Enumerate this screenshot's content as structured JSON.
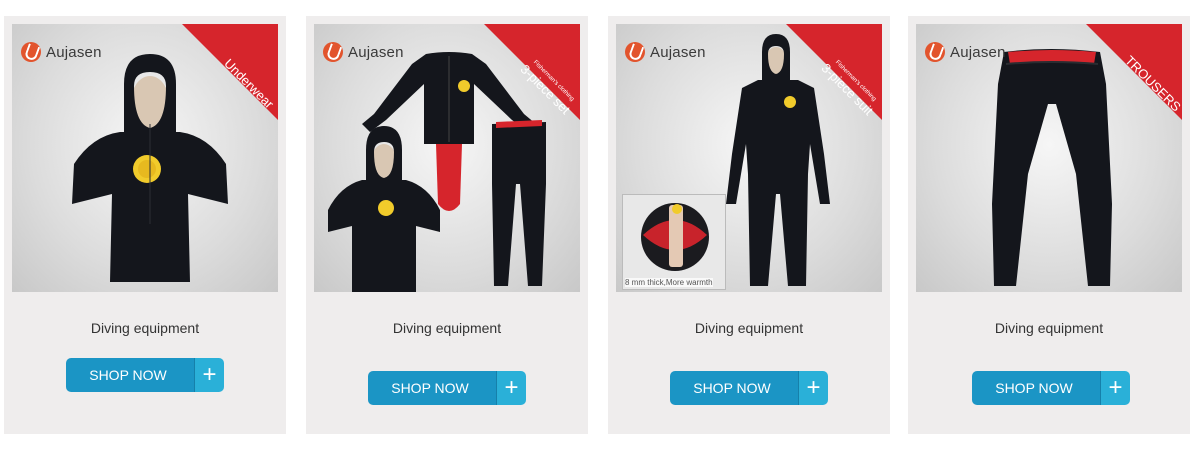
{
  "brand": "Aujasen",
  "products": [
    {
      "ribbon_small": "",
      "ribbon_big": "Underwear",
      "title": "Diving equipment",
      "button_label": "SHOP NOW",
      "plus_icon": "+"
    },
    {
      "ribbon_small": "Fisherman's clothing",
      "ribbon_big": "3-piece set",
      "title": "Diving equipment",
      "button_label": "SHOP NOW",
      "plus_icon": "+"
    },
    {
      "ribbon_small": "Fisherman's clothing",
      "ribbon_big": "3-piece suit",
      "title": "Diving equipment",
      "button_label": "SHOP NOW",
      "plus_icon": "+",
      "inset_caption": "8 mm thick,More warmth"
    },
    {
      "ribbon_small": "",
      "ribbon_big": "TROUSERS",
      "title": "Diving equipment",
      "button_label": "SHOP NOW",
      "plus_icon": "+"
    }
  ],
  "colors": {
    "ribbon": "#d6252c",
    "button": "#1b95c5",
    "button_plus": "#2ab0d8",
    "logo": "#e2542d",
    "card_bg": "#efeded"
  }
}
